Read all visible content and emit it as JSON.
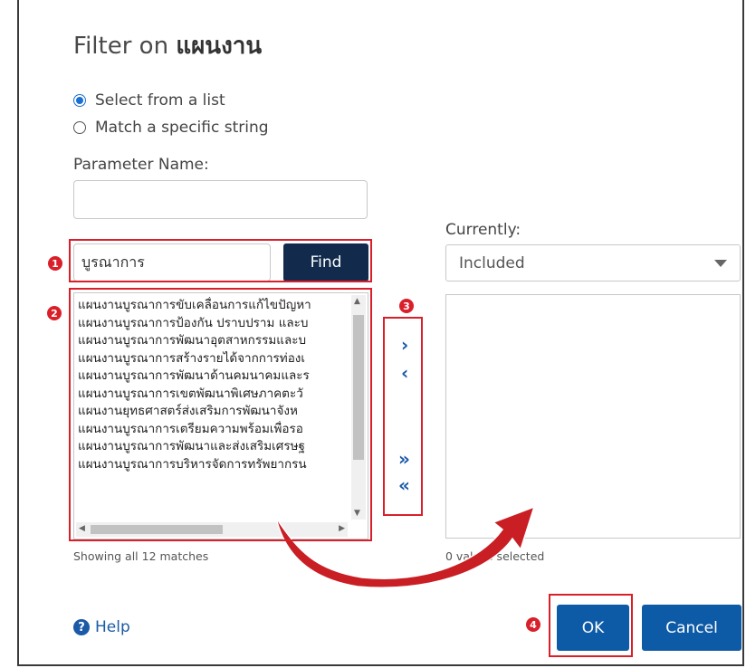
{
  "dialog": {
    "title_prefix": "Filter on",
    "title_field": "แผนงาน",
    "radio_select_list": "Select from a list",
    "radio_match_string": "Match a specific string",
    "parameter_name_label": "Parameter Name:",
    "parameter_name_value": ""
  },
  "search": {
    "value": "บูรณาการ",
    "find_label": "Find"
  },
  "currently": {
    "label": "Currently:",
    "selected": "Included"
  },
  "list": {
    "items": [
      "แผนงานบูรณาการขับเคลื่อนการแก้ไขปัญหา",
      "แผนงานบูรณาการป้องกัน ปราบปราม และบ",
      "แผนงานบูรณาการพัฒนาอุตสาหกรรมและบ",
      "แผนงานบูรณาการสร้างรายได้จากการท่องเ",
      "แผนงานบูรณาการพัฒนาด้านคมนาคมและร",
      "แผนงานบูรณาการเขตพัฒนาพิเศษภาคตะวั",
      "แผนงานยุทธศาสตร์ส่งเสริมการพัฒนาจังห",
      "แผนงานบูรณาการเตรียมความพร้อมเพื่อรอ",
      "แผนงานบูรณาการพัฒนาและส่งเสริมเศรษฐ",
      "แผนงานบูรณาการบริหารจัดการทรัพยากรน"
    ],
    "matches_text": "Showing all 12 matches"
  },
  "move_buttons": {
    "add": "›",
    "remove": "‹",
    "add_all": "»",
    "remove_all": "«"
  },
  "selected": {
    "status_text": "0 values selected"
  },
  "footer": {
    "help_label": "Help",
    "ok_label": "OK",
    "cancel_label": "Cancel"
  },
  "annotations": {
    "badges": [
      "1",
      "2",
      "3",
      "4"
    ],
    "color": "#d9202a"
  }
}
